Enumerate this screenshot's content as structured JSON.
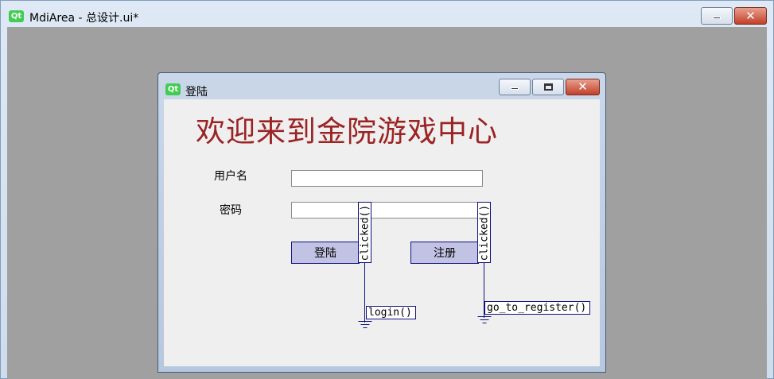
{
  "outer_window": {
    "logo": "Qt",
    "title": "MdiArea - 总设计.ui*",
    "buttons": [
      "minimize-button",
      "close-button"
    ]
  },
  "sub_window": {
    "logo": "Qt",
    "title": "登陆",
    "buttons": [
      "minimize-button",
      "maximize-button",
      "close-button"
    ]
  },
  "form": {
    "heading": "欢迎来到金院游戏中心",
    "username_label": "用户名",
    "username_value": "",
    "password_label": "密码",
    "password_value": "",
    "login_button": "登陆",
    "register_button": "注册"
  },
  "connections": [
    {
      "signal": "clicked()",
      "slot": "login()"
    },
    {
      "signal": "clicked()",
      "slot": "go_to_register()"
    }
  ],
  "colors": {
    "heading": "#9b2324",
    "connection_line": "#10107d",
    "button_fill": "#c2c2e4",
    "mdi_background": "#a0a0a0"
  },
  "icons": {
    "app_logo": "qt-logo-icon",
    "minimize": "minimize-icon",
    "maximize": "maximize-icon",
    "close": "close-icon",
    "ground": "ground-icon"
  }
}
